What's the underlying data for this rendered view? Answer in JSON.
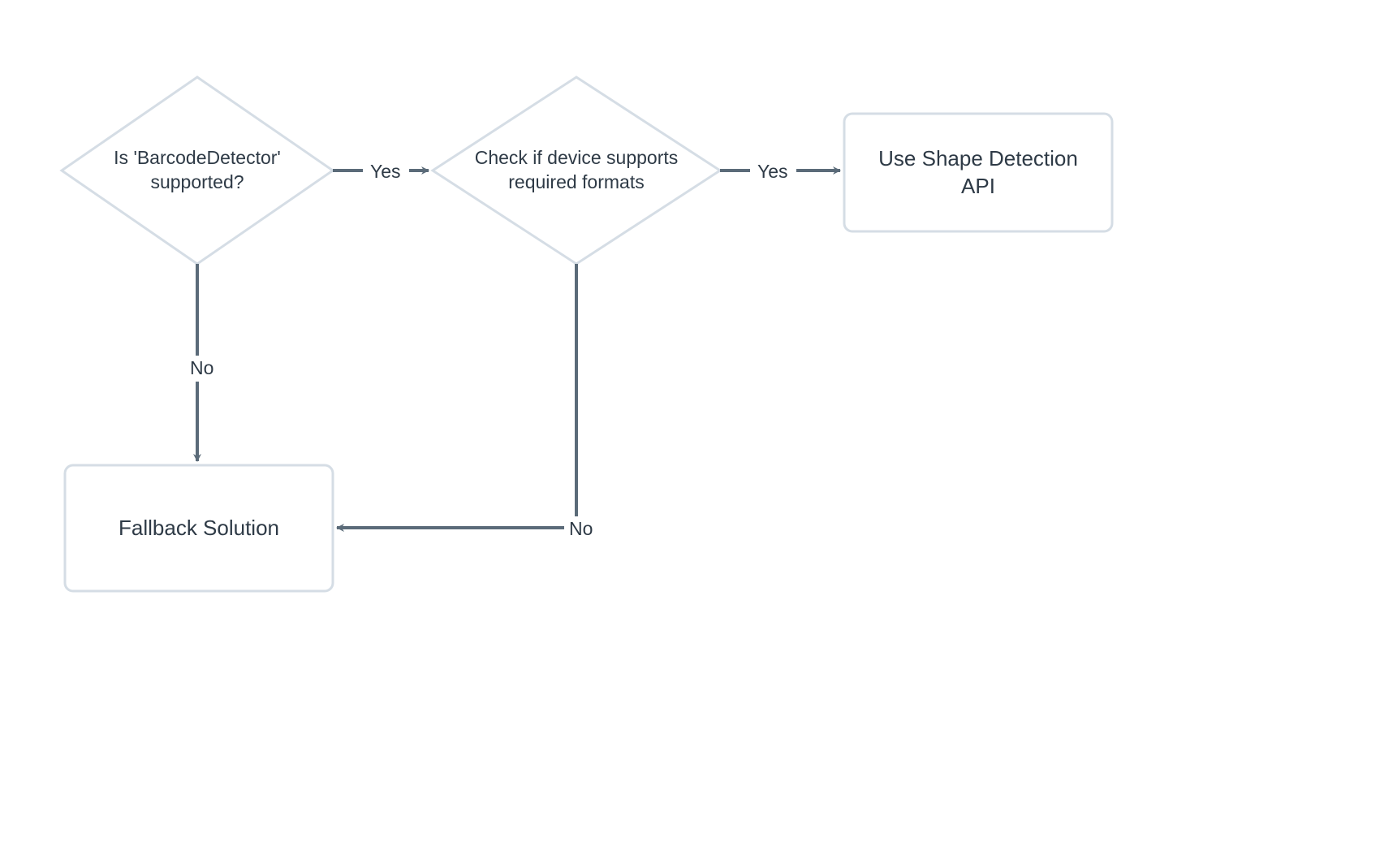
{
  "nodes": {
    "decision1": {
      "line1": "Is 'BarcodeDetector'",
      "line2": "supported?"
    },
    "decision2": {
      "line1": "Check if device supports",
      "line2": "required formats"
    },
    "process_api": {
      "line1": "Use Shape Detection",
      "line2": "API"
    },
    "process_fallback": {
      "label": "Fallback Solution"
    }
  },
  "edges": {
    "d1_yes": "Yes",
    "d1_no": "No",
    "d2_yes": "Yes",
    "d2_no": "No"
  },
  "colors": {
    "shape_stroke": "#d5dde5",
    "arrow_stroke": "#5b6b79",
    "text": "#2e3a46",
    "bg": "#ffffff"
  }
}
